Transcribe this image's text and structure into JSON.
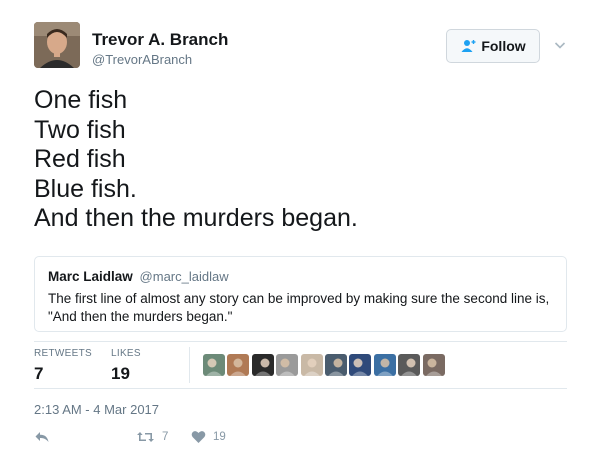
{
  "author": {
    "name": "Trevor A. Branch",
    "handle": "@TrevorABranch"
  },
  "follow_button": {
    "label": "Follow"
  },
  "tweet": {
    "lines": [
      "One fish",
      "Two fish",
      "Red fish",
      "Blue fish.",
      "And then the murders began."
    ]
  },
  "quoted_tweet": {
    "name": "Marc Laidlaw",
    "handle": "@marc_laidlaw",
    "text": "The first line of almost any story can be improved by making sure the second line is, \"And then the murders began.\""
  },
  "stats": {
    "retweets_label": "RETWEETS",
    "retweets_count": "7",
    "likes_label": "LIKES",
    "likes_count": "19"
  },
  "likers": [
    {
      "icon": "liker-avatar-1",
      "color": "#6c8a78"
    },
    {
      "icon": "liker-avatar-2",
      "color": "#b07a55"
    },
    {
      "icon": "liker-avatar-3",
      "color": "#2a2a2a"
    },
    {
      "icon": "liker-avatar-4",
      "color": "#9a9a9a"
    },
    {
      "icon": "liker-avatar-5",
      "color": "#c9b9a6"
    },
    {
      "icon": "liker-avatar-6",
      "color": "#4a5c6e"
    },
    {
      "icon": "liker-avatar-7",
      "color": "#2f4a7a"
    },
    {
      "icon": "liker-avatar-8",
      "color": "#3b6fa3"
    },
    {
      "icon": "liker-avatar-9",
      "color": "#5a5a5a"
    },
    {
      "icon": "liker-avatar-10",
      "color": "#7a6a62"
    }
  ],
  "timestamp": "2:13 AM - 4 Mar 2017",
  "actions": {
    "retweet_count": "7",
    "like_count": "19"
  },
  "colors": {
    "accent": "#1da1f2",
    "muted": "#657786",
    "icon_muted": "#8899a6",
    "border": "#e1e8ed"
  }
}
